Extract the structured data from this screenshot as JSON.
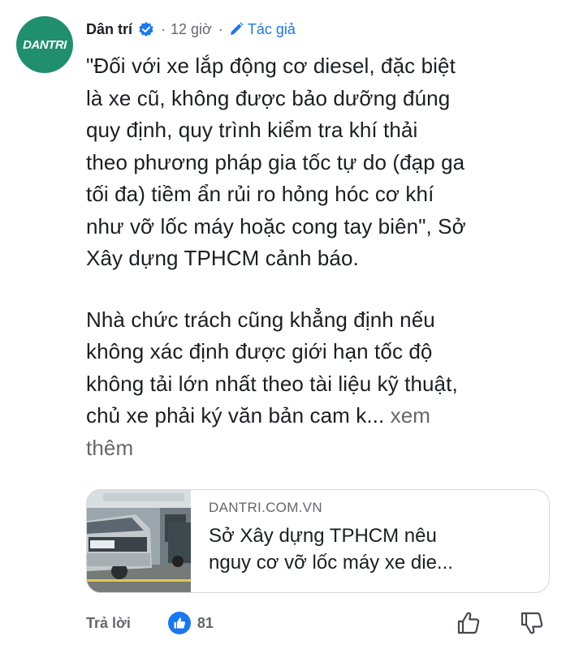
{
  "post": {
    "author": "Dân trí",
    "separator": "·",
    "time": "12 giờ",
    "separator2": "·",
    "author_tag": "Tác giả",
    "avatar_text": "DANTRI",
    "paragraph1_lines": [
      "\"Đối với xe lắp động cơ diesel, đặc biệt",
      "là xe cũ, không được bảo dưỡng đúng",
      "quy định, quy trình kiểm tra khí thải",
      "theo phương pháp gia tốc tự do (đạp ga",
      "tối đa) tiềm ẩn rủi ro hỏng hóc cơ khí",
      "như vỡ lốc máy hoặc cong tay biên\", Sở",
      "Xây dựng TPHCM cảnh báo."
    ],
    "paragraph2_lines": [
      "Nhà chức trách cũng khẳng định nếu",
      "không xác định được giới hạn tốc độ",
      "không tải lớn nhất theo tài liệu kỹ thuật,"
    ],
    "paragraph2_last": "chủ xe phải ký văn bản cam k...",
    "see_more_1": "xem",
    "see_more_2": "thêm"
  },
  "link_card": {
    "domain": "DANTRI.COM.VN",
    "title_line1": "Sở Xây dựng TPHCM nêu",
    "title_line2": "nguy cơ vỡ lốc máy xe die..."
  },
  "footer": {
    "reply_label": "Trả lời",
    "like_count": "81"
  },
  "colors": {
    "accent": "#1877f2",
    "avatar_bg": "#1f8f6e",
    "muted": "#65676b"
  },
  "icons": [
    "verified-badge-icon",
    "pencil-icon",
    "like-icon",
    "thumbs-up-icon",
    "thumbs-down-icon"
  ]
}
